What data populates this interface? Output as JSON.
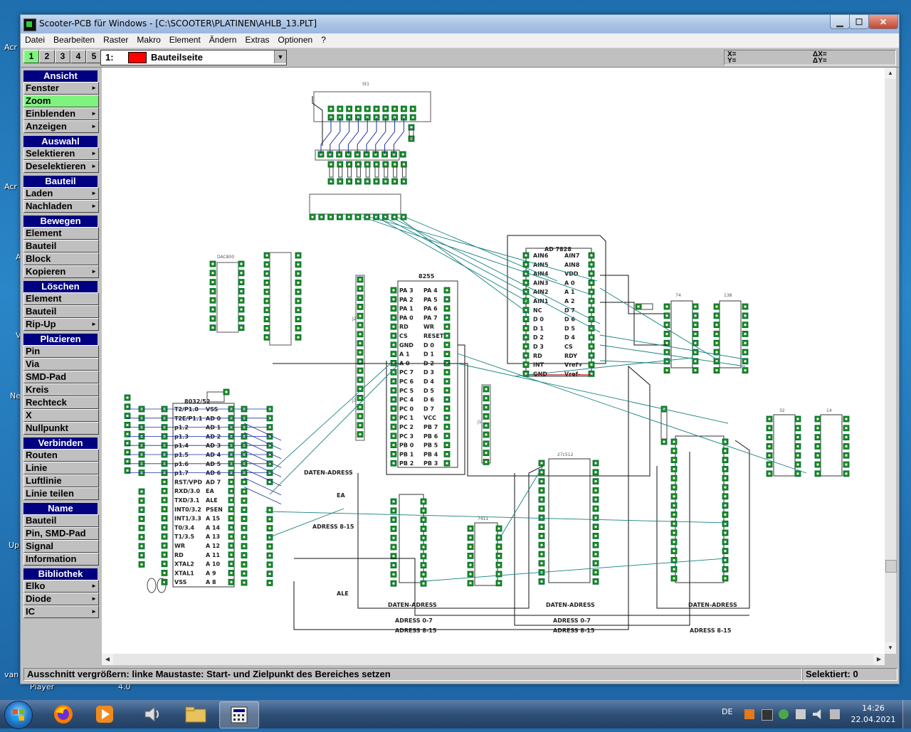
{
  "window": {
    "title": "Scooter-PCB für Windows - [C:\\SCOOTER\\PLATINEN\\AHLB_13.PLT]",
    "min_label": "▁",
    "max_label": "☐",
    "close_label": "✕"
  },
  "menu": [
    "Datei",
    "Bearbeiten",
    "Raster",
    "Makro",
    "Element",
    "Ändern",
    "Extras",
    "Optionen",
    "?"
  ],
  "toolbar": {
    "layer_tabs": [
      "1",
      "2",
      "3",
      "4",
      "5"
    ],
    "layer_number": "1:",
    "layer_name": "Bauteilseite",
    "coords": {
      "x_label": "X=",
      "y_label": "Y=",
      "dx_label": "ΔX=",
      "dy_label": "ΔY="
    }
  },
  "sidebar": {
    "groups": [
      {
        "title": "Ansicht",
        "items": [
          {
            "label": "Fenster",
            "arrow": true
          },
          {
            "label": "Zoom",
            "active": true
          },
          {
            "label": "Einblenden",
            "arrow": true
          },
          {
            "label": "Anzeigen",
            "arrow": true
          }
        ]
      },
      {
        "title": "Auswahl",
        "items": [
          {
            "label": "Selektieren",
            "arrow": true
          },
          {
            "label": "Deselektieren",
            "arrow": true
          }
        ]
      },
      {
        "title": "Bauteil",
        "items": [
          {
            "label": "Laden",
            "arrow": true
          },
          {
            "label": "Nachladen",
            "arrow": true
          }
        ]
      },
      {
        "title": "Bewegen",
        "items": [
          {
            "label": "Element"
          },
          {
            "label": "Bauteil"
          },
          {
            "label": "Block"
          },
          {
            "label": "Kopieren",
            "arrow": true
          }
        ]
      },
      {
        "title": "Löschen",
        "items": [
          {
            "label": "Element"
          },
          {
            "label": "Bauteil"
          },
          {
            "label": "Rip-Up",
            "arrow": true
          }
        ]
      },
      {
        "title": "Plazieren",
        "items": [
          {
            "label": "Pin"
          },
          {
            "label": "Via"
          },
          {
            "label": "SMD-Pad"
          },
          {
            "label": "Kreis"
          },
          {
            "label": "Rechteck"
          },
          {
            "label": "X"
          },
          {
            "label": "Nullpunkt"
          }
        ]
      },
      {
        "title": "Verbinden",
        "items": [
          {
            "label": "Routen"
          },
          {
            "label": "Linie"
          },
          {
            "label": "Luftlinie"
          },
          {
            "label": "Linie teilen"
          }
        ]
      },
      {
        "title": "Name",
        "items": [
          {
            "label": "Bauteil"
          },
          {
            "label": "Pin, SMD-Pad"
          },
          {
            "label": "Signal"
          },
          {
            "label": "Information"
          }
        ]
      },
      {
        "title": "Bibliothek",
        "items": [
          {
            "label": "Elko",
            "arrow": true
          },
          {
            "label": "Diode",
            "arrow": true
          },
          {
            "label": "IC",
            "arrow": true
          }
        ]
      }
    ]
  },
  "pcb": {
    "components": {
      "st1": "St1",
      "ad7828": "AD 7828",
      "ppi8255": "8255",
      "mcu": "8032/52",
      "eprom": "27c512",
      "ram": "74",
      "dec": "138",
      "dac": "DAC800",
      "latch": "7411",
      "ic32": "32",
      "ic14": "14",
      "j2": "J2",
      "j3": "J3",
      "j1": "J1"
    },
    "labels": {
      "daten_adress": "DATEN-ADRESS",
      "ea": "EA",
      "adress_8_15": "ADRESS 8-15",
      "ale": "ALE",
      "adress_0_7": "ADRESS 0-7"
    },
    "ad7828_pins_left": [
      "AIN6",
      "AIN5",
      "AIN4",
      "AIN3",
      "AIN2",
      "AIN1",
      "NC",
      "D 0",
      "D 1",
      "D 2",
      "D 3",
      "RD",
      "INT",
      "GND"
    ],
    "ad7828_pins_right": [
      "AIN7",
      "AIN8",
      "VDD",
      "A 0",
      "A 1",
      "A 2",
      "D 7",
      "D 6",
      "D 5",
      "D 4",
      "CS",
      "RDY",
      "Vref+",
      "Vref-"
    ],
    "ppi_pins_left": [
      "PA 3",
      "PA 2",
      "PA 1",
      "PA 0",
      "RD",
      "CS",
      "GND",
      "A 1",
      "A 0",
      "PC 7",
      "PC 6",
      "PC 5",
      "PC 4",
      "PC 0",
      "PC 1",
      "PC 2",
      "PC 3",
      "PB 0",
      "PB 1",
      "PB 2"
    ],
    "ppi_pins_right": [
      "PA 4",
      "PA 5",
      "PA 6",
      "PA 7",
      "WR",
      "RESET",
      "D 0",
      "D 1",
      "D 2",
      "D 3",
      "D 4",
      "D 5",
      "D 6",
      "D 7",
      "VCC",
      "PB 7",
      "PB 6",
      "PB 5",
      "PB 4",
      "PB 3"
    ],
    "mcu_pins_left": [
      "T2/P1.0",
      "T2E/P1.1",
      "p1.2",
      "p1.3",
      "p1.4",
      "p1.5",
      "p1.6",
      "p1.7",
      "RST/VPD",
      "RXD/3.0",
      "TXD/3.1",
      "INT0/3.2",
      "INT1/3.3",
      "T0/3.4",
      "T1/3.5",
      "WR",
      "RD",
      "XTAL2",
      "XTAL1",
      "VSS"
    ],
    "mcu_pins_right": [
      "VSS",
      "AD 0",
      "AD 1",
      "AD 2",
      "AD 3",
      "AD 4",
      "AD 5",
      "AD 6",
      "AD 7",
      "EA",
      "ALE",
      "PSEN",
      "A 15",
      "A 14",
      "A 13",
      "A 12",
      "A 11",
      "A 10",
      "A 9",
      "A 8"
    ]
  },
  "status": {
    "left": "Ausschnitt vergrößern:   linke Maustaste: Start- und Zielpunkt des Bereiches setzen",
    "right": "Selektiert: 0"
  },
  "desktop_labels": [
    "Acr",
    "Acr",
    "A",
    "V",
    "Ne",
    "Up",
    "van",
    "Player",
    "4.0"
  ],
  "taskbar": {
    "apps": [
      "firefox",
      "media-player",
      "speaker-app",
      "file-explorer",
      "scooter-pcb"
    ],
    "lang": "DE",
    "time": "14:26",
    "date": "22.04.2021"
  }
}
